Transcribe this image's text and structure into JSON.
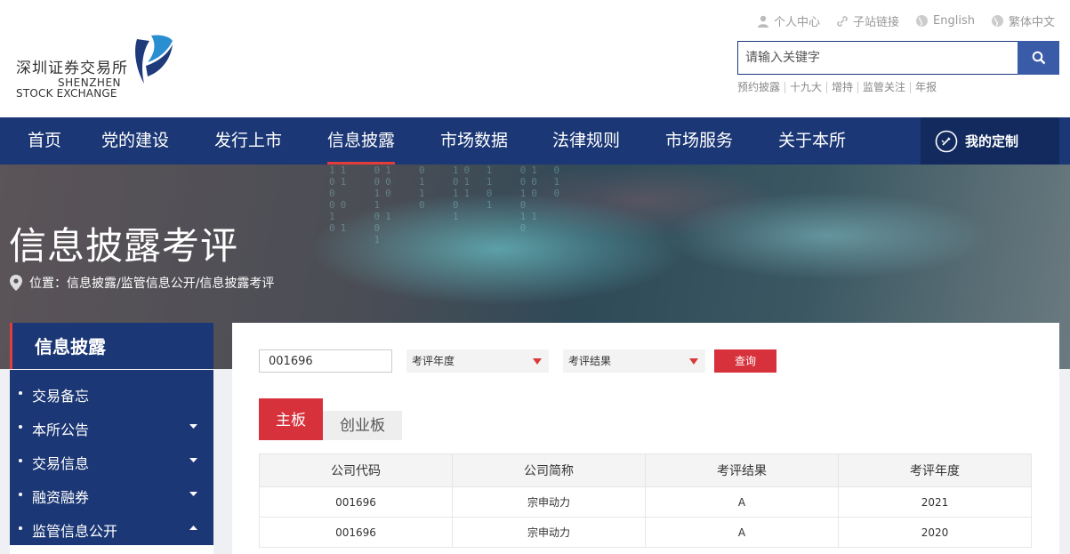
{
  "header": {
    "logo_cn": "深圳证券交易所",
    "logo_en_line1": "SHENZHEN",
    "logo_en_line2": "STOCK EXCHANGE",
    "top_links": [
      {
        "label": "个人中心",
        "icon": "person-icon"
      },
      {
        "label": "子站链接",
        "icon": "link-icon"
      },
      {
        "label": "English",
        "icon": "globe-icon"
      },
      {
        "label": "繁体中文",
        "icon": "globe-icon"
      }
    ],
    "search_placeholder": "请输入关键字",
    "hot_words": [
      "预约披露",
      "十九大",
      "增持",
      "监管关注",
      "年报"
    ]
  },
  "nav": {
    "items": [
      "首页",
      "党的建设",
      "发行上市",
      "信息披露",
      "市场数据",
      "法律规则",
      "市场服务",
      "关于本所"
    ],
    "active": "信息披露",
    "custom_label": "我的定制"
  },
  "banner": {
    "title": "信息披露考评",
    "breadcrumb": "位置：信息披露/监管信息公开/信息披露考评"
  },
  "sidebar": {
    "heading": "信息披露",
    "items": [
      {
        "label": "交易备忘",
        "caret": "none"
      },
      {
        "label": "本所公告",
        "caret": "down"
      },
      {
        "label": "交易信息",
        "caret": "down"
      },
      {
        "label": "融资融券",
        "caret": "down"
      },
      {
        "label": "监管信息公开",
        "caret": "up"
      }
    ]
  },
  "filters": {
    "code_value": "001696",
    "year_select": "考评年度",
    "result_select": "考评结果",
    "query_label": "查询"
  },
  "tabs": [
    "主板",
    "创业板"
  ],
  "table": {
    "headers": [
      "公司代码",
      "公司简称",
      "考评结果",
      "考评年度"
    ],
    "rows": [
      [
        "001696",
        "宗申动力",
        "A",
        "2021"
      ],
      [
        "001696",
        "宗申动力",
        "A",
        "2020"
      ]
    ]
  },
  "colors": {
    "nav_bg": "#1b3775",
    "accent_red": "#d7323c",
    "search_button": "#3a5ba8"
  }
}
